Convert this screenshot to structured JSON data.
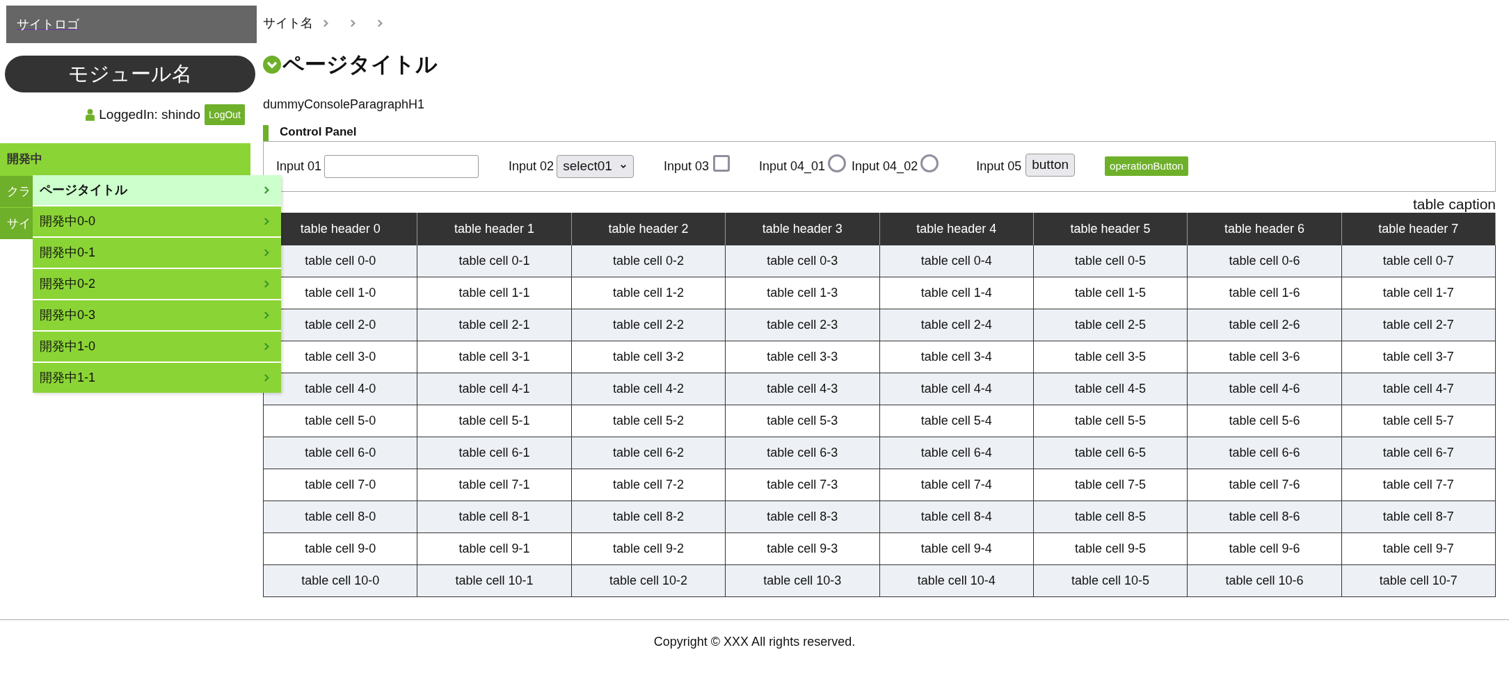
{
  "sidebar": {
    "logo": "サイトロゴ",
    "module": "モジュール名",
    "user": "LoggedIn: shindo",
    "logout": "LogOut",
    "nav": [
      {
        "label": "開発中",
        "selected": true
      },
      {
        "label": "クラ",
        "selected": false
      },
      {
        "label": "サイ",
        "selected": false
      }
    ],
    "flyout": [
      {
        "label": "ページタイトル",
        "selected": true
      },
      {
        "label": "開発中0-0",
        "selected": false
      },
      {
        "label": "開発中0-1",
        "selected": false
      },
      {
        "label": "開発中0-2",
        "selected": false
      },
      {
        "label": "開発中0-3",
        "selected": false
      },
      {
        "label": "開発中1-0",
        "selected": false
      },
      {
        "label": "開発中1-1",
        "selected": false
      }
    ]
  },
  "breadcrumb": [
    "サイト名"
  ],
  "page_title": "ページタイトル",
  "paragraph": "dummyConsoleParagraphH1",
  "control_panel": {
    "title": "Control Panel",
    "input01": {
      "label": "Input 01"
    },
    "input02": {
      "label": "Input 02",
      "value": "select01"
    },
    "input03": {
      "label": "Input 03",
      "checked": false
    },
    "radios": [
      {
        "label": "Input 04_01",
        "selected": false
      },
      {
        "label": "Input 04_02",
        "selected": false
      }
    ],
    "input05": {
      "label": "Input 05",
      "button": "button"
    },
    "operation_button": "operationButton"
  },
  "table": {
    "caption": "table caption",
    "columns": [
      "table header 0",
      "table header 1",
      "table header 2",
      "table header 3",
      "table header 4",
      "table header 5",
      "table header 6",
      "table header 7"
    ],
    "rows": [
      [
        "table cell 0-0",
        "table cell 0-1",
        "table cell 0-2",
        "table cell 0-3",
        "table cell 0-4",
        "table cell 0-5",
        "table cell 0-6",
        "table cell 0-7"
      ],
      [
        "table cell 1-0",
        "table cell 1-1",
        "table cell 1-2",
        "table cell 1-3",
        "table cell 1-4",
        "table cell 1-5",
        "table cell 1-6",
        "table cell 1-7"
      ],
      [
        "table cell 2-0",
        "table cell 2-1",
        "table cell 2-2",
        "table cell 2-3",
        "table cell 2-4",
        "table cell 2-5",
        "table cell 2-6",
        "table cell 2-7"
      ],
      [
        "table cell 3-0",
        "table cell 3-1",
        "table cell 3-2",
        "table cell 3-3",
        "table cell 3-4",
        "table cell 3-5",
        "table cell 3-6",
        "table cell 3-7"
      ],
      [
        "table cell 4-0",
        "table cell 4-1",
        "table cell 4-2",
        "table cell 4-3",
        "table cell 4-4",
        "table cell 4-5",
        "table cell 4-6",
        "table cell 4-7"
      ],
      [
        "table cell 5-0",
        "table cell 5-1",
        "table cell 5-2",
        "table cell 5-3",
        "table cell 5-4",
        "table cell 5-5",
        "table cell 5-6",
        "table cell 5-7"
      ],
      [
        "table cell 6-0",
        "table cell 6-1",
        "table cell 6-2",
        "table cell 6-3",
        "table cell 6-4",
        "table cell 6-5",
        "table cell 6-6",
        "table cell 6-7"
      ],
      [
        "table cell 7-0",
        "table cell 7-1",
        "table cell 7-2",
        "table cell 7-3",
        "table cell 7-4",
        "table cell 7-5",
        "table cell 7-6",
        "table cell 7-7"
      ],
      [
        "table cell 8-0",
        "table cell 8-1",
        "table cell 8-2",
        "table cell 8-3",
        "table cell 8-4",
        "table cell 8-5",
        "table cell 8-6",
        "table cell 8-7"
      ],
      [
        "table cell 9-0",
        "table cell 9-1",
        "table cell 9-2",
        "table cell 9-3",
        "table cell 9-4",
        "table cell 9-5",
        "table cell 9-6",
        "table cell 9-7"
      ],
      [
        "table cell 10-0",
        "table cell 10-1",
        "table cell 10-2",
        "table cell 10-3",
        "table cell 10-4",
        "table cell 10-5",
        "table cell 10-6",
        "table cell 10-7"
      ]
    ]
  },
  "footer": "Copyright © XXX All rights reserved."
}
